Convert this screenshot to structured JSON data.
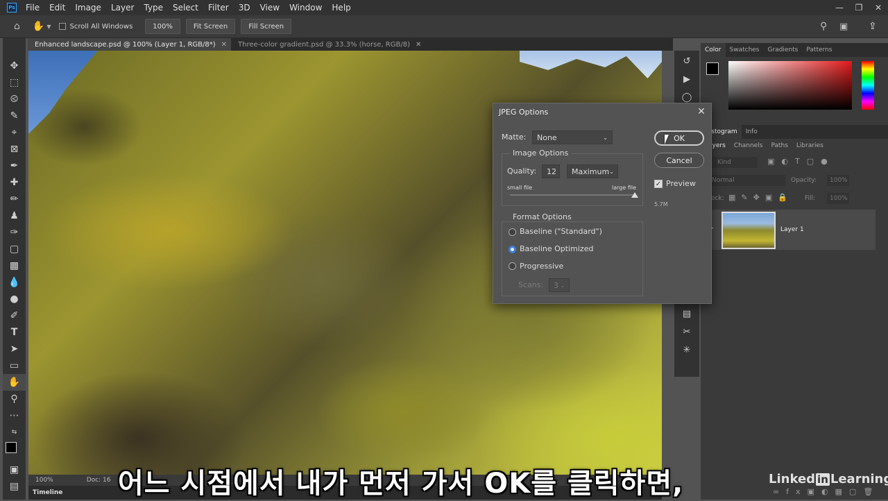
{
  "app": {
    "logo_text": "Ps"
  },
  "menu": [
    "File",
    "Edit",
    "Image",
    "Layer",
    "Type",
    "Select",
    "Filter",
    "3D",
    "View",
    "Window",
    "Help"
  ],
  "options_bar": {
    "scroll_all_windows": "Scroll All Windows",
    "zoom": "100%",
    "fit_screen": "Fit Screen",
    "fill_screen": "Fill Screen"
  },
  "tabs": [
    {
      "label": "Enhanced landscape.psd @ 100% (Layer 1, RGB/8*)",
      "active": true
    },
    {
      "label": "Three-color gradient.psd @ 33.3% (horse, RGB/8)",
      "active": false
    }
  ],
  "status": {
    "zoom": "100%",
    "doc": "Doc: 16"
  },
  "timeline": "Timeline",
  "panels": {
    "color_tabs": [
      "Color",
      "Swatches",
      "Gradients",
      "Patterns"
    ],
    "mid_tabs": [
      "Histogram",
      "Info"
    ],
    "layer_tabs": [
      "Layers",
      "Channels",
      "Paths",
      "Libraries"
    ],
    "kind": "Kind",
    "blend": "Normal",
    "opacity_label": "Opacity:",
    "opacity_value": "100%",
    "lock_label": "Lock:",
    "fill_label": "Fill:",
    "fill_value": "100%",
    "layer_name": "Layer 1"
  },
  "dialog": {
    "title": "JPEG Options",
    "matte_label": "Matte:",
    "matte_value": "None",
    "image_options": "Image Options",
    "quality_label": "Quality:",
    "quality_value": "12",
    "quality_preset": "Maximum",
    "small_file": "small file",
    "large_file": "large file",
    "quality_slider_fraction": 1.0,
    "format_options": "Format Options",
    "radio_baseline_standard": "Baseline (\"Standard\")",
    "radio_baseline_optimized": "Baseline Optimized",
    "radio_progressive": "Progressive",
    "selected_format": "Baseline Optimized",
    "scans_label": "Scans:",
    "scans_value": "3",
    "ok": "OK",
    "cancel": "Cancel",
    "preview": "Preview",
    "preview_checked": true,
    "file_size": "5.7M"
  },
  "subtitle": "어느 시점에서 내가 먼저 가서 OK를 클릭하면,",
  "watermark": {
    "pre": "Linked",
    "in": "in",
    "post": "Learning"
  }
}
